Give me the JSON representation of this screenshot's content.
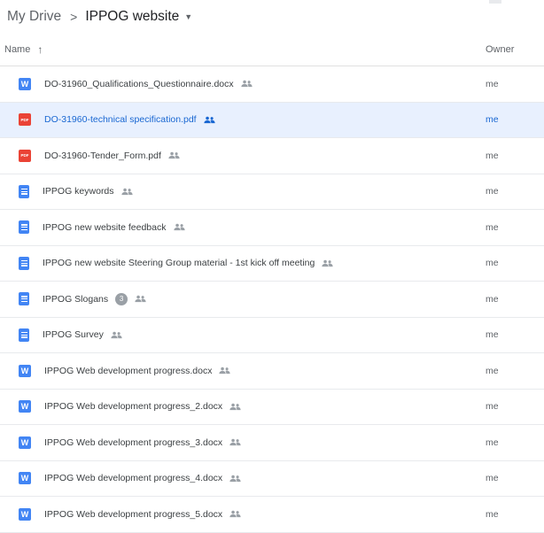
{
  "breadcrumb": {
    "root": "My Drive",
    "separator": ">",
    "current": "IPPOG website"
  },
  "header": {
    "name_label": "Name",
    "sort_arrow": "↑",
    "owner_label": "Owner"
  },
  "files": [
    {
      "name": "DO-31960_Qualifications_Questionnaire.docx",
      "type": "word",
      "owner": "me",
      "selected": false,
      "badge": ""
    },
    {
      "name": "DO-31960-technical specification.pdf",
      "type": "pdf",
      "owner": "me",
      "selected": true,
      "badge": ""
    },
    {
      "name": "DO-31960-Tender_Form.pdf",
      "type": "pdf",
      "owner": "me",
      "selected": false,
      "badge": ""
    },
    {
      "name": "IPPOG keywords",
      "type": "doc",
      "owner": "me",
      "selected": false,
      "badge": ""
    },
    {
      "name": "IPPOG new website feedback",
      "type": "doc",
      "owner": "me",
      "selected": false,
      "badge": ""
    },
    {
      "name": "IPPOG new website Steering Group material - 1st kick off meeting",
      "type": "doc",
      "owner": "me",
      "selected": false,
      "badge": ""
    },
    {
      "name": "IPPOG Slogans",
      "type": "doc",
      "owner": "me",
      "selected": false,
      "badge": "3"
    },
    {
      "name": "IPPOG Survey",
      "type": "doc",
      "owner": "me",
      "selected": false,
      "badge": ""
    },
    {
      "name": "IPPOG Web development progress.docx",
      "type": "word",
      "owner": "me",
      "selected": false,
      "badge": ""
    },
    {
      "name": "IPPOG Web development progress_2.docx",
      "type": "word",
      "owner": "me",
      "selected": false,
      "badge": ""
    },
    {
      "name": "IPPOG Web development progress_3.docx",
      "type": "word",
      "owner": "me",
      "selected": false,
      "badge": ""
    },
    {
      "name": "IPPOG Web development progress_4.docx",
      "type": "word",
      "owner": "me",
      "selected": false,
      "badge": ""
    },
    {
      "name": "IPPOG Web development progress_5.docx",
      "type": "word",
      "owner": "me",
      "selected": false,
      "badge": ""
    }
  ],
  "icons": {
    "word_letter": "W",
    "pdf_letter": "PDF",
    "shared": "people-icon",
    "dropdown": "caret-down-icon"
  },
  "colors": {
    "selected_bg": "#e8f0fe",
    "selected_text": "#1967d2",
    "word_icon": "#4285f4",
    "pdf_icon": "#ea4335",
    "doc_icon": "#4285f4"
  }
}
